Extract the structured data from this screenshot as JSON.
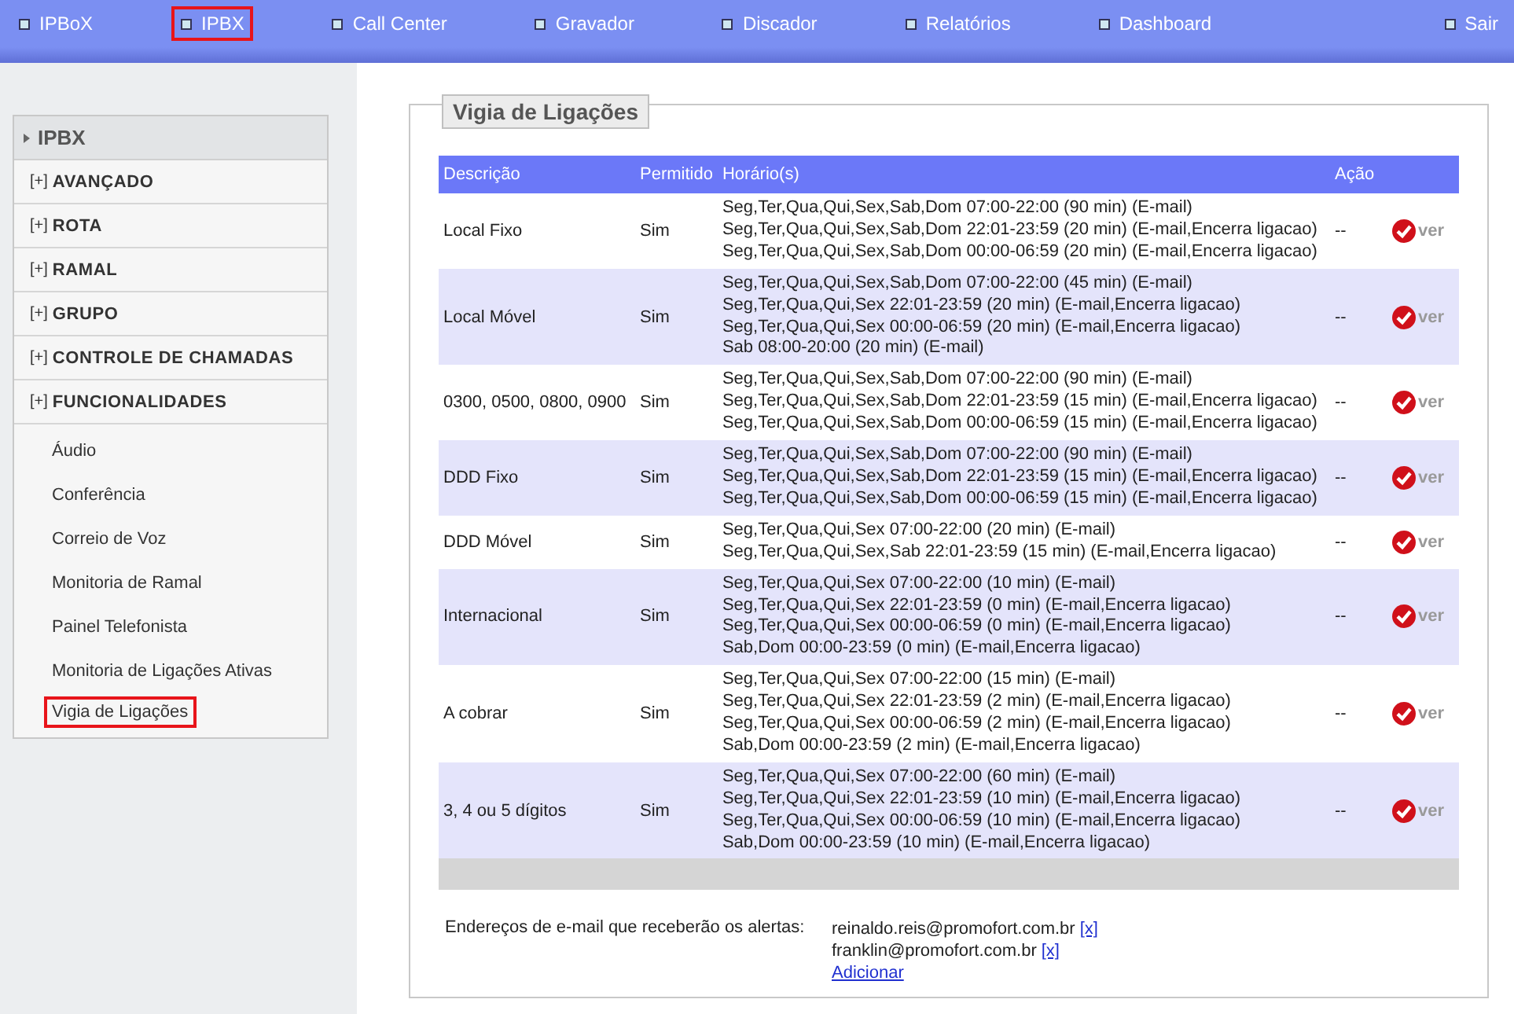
{
  "nav": {
    "items": [
      {
        "label": "IPBoX",
        "selected": false
      },
      {
        "label": "IPBX",
        "selected": true
      },
      {
        "label": "Call Center",
        "selected": false
      },
      {
        "label": "Gravador",
        "selected": false
      },
      {
        "label": "Discador",
        "selected": false
      },
      {
        "label": "Relatórios",
        "selected": false
      },
      {
        "label": "Dashboard",
        "selected": false
      }
    ],
    "logout": "Sair"
  },
  "sidebar": {
    "title": "IPBX",
    "groups": [
      {
        "toggle": "[+]",
        "label": "AVANÇADO"
      },
      {
        "toggle": "[+]",
        "label": "ROTA"
      },
      {
        "toggle": "[+]",
        "label": "RAMAL"
      },
      {
        "toggle": "[+]",
        "label": "GRUPO"
      },
      {
        "toggle": "[+]",
        "label": "CONTROLE DE CHAMADAS"
      },
      {
        "toggle": "[+]",
        "label": "FUNCIONALIDADES",
        "children": [
          {
            "label": "Áudio",
            "selected": false
          },
          {
            "label": "Conferência",
            "selected": false
          },
          {
            "label": "Correio de Voz",
            "selected": false
          },
          {
            "label": "Monitoria de Ramal",
            "selected": false
          },
          {
            "label": "Painel Telefonista",
            "selected": false
          },
          {
            "label": "Monitoria de Ligações Ativas",
            "selected": false
          },
          {
            "label": "Vigia de Ligações",
            "selected": true
          }
        ]
      }
    ]
  },
  "panel": {
    "title": "Vigia de Ligações",
    "table": {
      "columns": [
        "Descrição",
        "Permitido",
        "Horário(s)",
        "Ação"
      ],
      "rows": [
        {
          "description": "Local Fixo",
          "allowed": "Sim",
          "schedules": [
            "Seg,Ter,Qua,Qui,Sex,Sab,Dom 07:00-22:00 (90 min) (E-mail)",
            "Seg,Ter,Qua,Qui,Sex,Sab,Dom 22:01-23:59 (20 min) (E-mail,Encerra ligacao)",
            "Seg,Ter,Qua,Qui,Sex,Sab,Dom 00:00-06:59 (20 min) (E-mail,Encerra ligacao)"
          ],
          "action": "--",
          "link": "ver"
        },
        {
          "description": "Local Móvel",
          "allowed": "Sim",
          "schedules": [
            "Seg,Ter,Qua,Qui,Sex,Sab,Dom 07:00-22:00 (45 min) (E-mail)",
            "Seg,Ter,Qua,Qui,Sex 22:01-23:59 (20 min) (E-mail,Encerra ligacao)",
            "Seg,Ter,Qua,Qui,Sex 00:00-06:59 (20 min) (E-mail,Encerra ligacao)",
            "Sab 08:00-20:00 (20 min) (E-mail)"
          ],
          "action": "--",
          "link": "ver"
        },
        {
          "description": "0300, 0500, 0800, 0900",
          "allowed": "Sim",
          "schedules": [
            "Seg,Ter,Qua,Qui,Sex,Sab,Dom 07:00-22:00 (90 min) (E-mail)",
            "Seg,Ter,Qua,Qui,Sex,Sab,Dom 22:01-23:59 (15 min) (E-mail,Encerra ligacao)",
            "Seg,Ter,Qua,Qui,Sex,Sab,Dom 00:00-06:59 (15 min) (E-mail,Encerra ligacao)"
          ],
          "action": "--",
          "link": "ver"
        },
        {
          "description": "DDD Fixo",
          "allowed": "Sim",
          "schedules": [
            "Seg,Ter,Qua,Qui,Sex,Sab,Dom 07:00-22:00 (90 min) (E-mail)",
            "Seg,Ter,Qua,Qui,Sex,Sab,Dom 22:01-23:59 (15 min) (E-mail,Encerra ligacao)",
            "Seg,Ter,Qua,Qui,Sex,Sab,Dom 00:00-06:59 (15 min) (E-mail,Encerra ligacao)"
          ],
          "action": "--",
          "link": "ver"
        },
        {
          "description": "DDD Móvel",
          "allowed": "Sim",
          "schedules": [
            "Seg,Ter,Qua,Qui,Sex 07:00-22:00 (20 min) (E-mail)",
            "Seg,Ter,Qua,Qui,Sex,Sab 22:01-23:59 (15 min) (E-mail,Encerra ligacao)"
          ],
          "action": "--",
          "link": "ver"
        },
        {
          "description": "Internacional",
          "allowed": "Sim",
          "schedules": [
            "Seg,Ter,Qua,Qui,Sex 07:00-22:00 (10 min) (E-mail)",
            "Seg,Ter,Qua,Qui,Sex 22:01-23:59 (0 min) (E-mail,Encerra ligacao)",
            "Seg,Ter,Qua,Qui,Sex 00:00-06:59 (0 min) (E-mail,Encerra ligacao)",
            "Sab,Dom 00:00-23:59 (0 min) (E-mail,Encerra ligacao)"
          ],
          "action": "--",
          "link": "ver"
        },
        {
          "description": "A cobrar",
          "allowed": "Sim",
          "schedules": [
            "Seg,Ter,Qua,Qui,Sex 07:00-22:00 (15 min) (E-mail)",
            "Seg,Ter,Qua,Qui,Sex 22:01-23:59 (2 min) (E-mail,Encerra ligacao)",
            "Seg,Ter,Qua,Qui,Sex 00:00-06:59 (2 min) (E-mail,Encerra ligacao)",
            "Sab,Dom 00:00-23:59 (2 min) (E-mail,Encerra ligacao)"
          ],
          "action": "--",
          "link": "ver"
        },
        {
          "description": "3, 4 ou 5 dígitos",
          "allowed": "Sim",
          "schedules": [
            "Seg,Ter,Qua,Qui,Sex 07:00-22:00 (60 min) (E-mail)",
            "Seg,Ter,Qua,Qui,Sex 22:01-23:59 (10 min) (E-mail,Encerra ligacao)",
            "Seg,Ter,Qua,Qui,Sex 00:00-06:59 (10 min) (E-mail,Encerra ligacao)",
            "Sab,Dom 00:00-23:59 (10 min) (E-mail,Encerra ligacao)"
          ],
          "action": "--",
          "link": "ver"
        }
      ]
    },
    "emails": {
      "label": "Endereços de e-mail que receberão os alertas:",
      "addresses": [
        {
          "address": "reinaldo.reis@promofort.com.br",
          "remove": "[x]"
        },
        {
          "address": "franklin@promofort.com.br",
          "remove": "[x]"
        }
      ],
      "add": "Adicionar"
    }
  }
}
